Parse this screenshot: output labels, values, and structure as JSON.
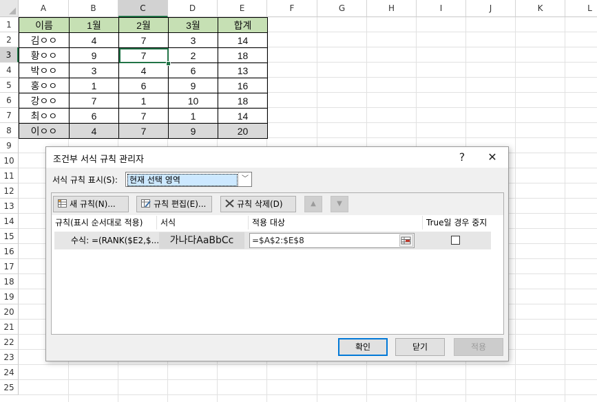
{
  "sheet": {
    "columns": [
      "A",
      "B",
      "C",
      "D",
      "E",
      "F",
      "G",
      "H",
      "I",
      "J",
      "K",
      "L"
    ],
    "rows": [
      "1",
      "2",
      "3",
      "4",
      "5",
      "6",
      "7",
      "8",
      "9",
      "10",
      "11",
      "12",
      "13",
      "14",
      "15",
      "16",
      "17",
      "18",
      "19",
      "20",
      "21",
      "22",
      "23",
      "24",
      "25"
    ],
    "selected_column": "C",
    "selected_row": "3",
    "table": [
      [
        "이름",
        "1월",
        "2월",
        "3월",
        "합계"
      ],
      [
        "김ㅇㅇ",
        "4",
        "7",
        "3",
        "14"
      ],
      [
        "황ㅇㅇ",
        "9",
        "7",
        "2",
        "18"
      ],
      [
        "박ㅇㅇ",
        "3",
        "4",
        "6",
        "13"
      ],
      [
        "홍ㅇㅇ",
        "1",
        "6",
        "9",
        "16"
      ],
      [
        "강ㅇㅇ",
        "7",
        "1",
        "10",
        "18"
      ],
      [
        "최ㅇㅇ",
        "6",
        "7",
        "1",
        "14"
      ],
      [
        "이ㅇㅇ",
        "4",
        "7",
        "9",
        "20"
      ]
    ],
    "colors": {
      "header_fill": "#c6e0b4",
      "highlight_fill": "#d9d9d9",
      "selection": "#217346"
    }
  },
  "dialog": {
    "title": "조건부 서식 규칙 관리자",
    "help_label": "?",
    "close_label": "✕",
    "show_rules_label": "서식 규칙 표시(S):",
    "show_rules_value": "현재 선택 영역",
    "toolbar": {
      "new_rule": "새 규칙(N)...",
      "edit_rule": "규칙 편집(E)...",
      "delete_rule": "규칙 삭제(D)",
      "move_up": "▲",
      "move_down": "▼"
    },
    "columns": {
      "rule": "규칙(표시 순서대로 적용)",
      "format": "서식",
      "applies_to": "적용 대상",
      "stop_if_true": "True일 경우 중지"
    },
    "rule": {
      "text": "수식: =(RANK($E2,$...",
      "preview": "가나다AaBbCc",
      "applies_to": "=$A$2:$E$8",
      "stop_if_true": false
    },
    "buttons": {
      "ok": "확인",
      "close": "닫기",
      "apply": "적용"
    }
  }
}
